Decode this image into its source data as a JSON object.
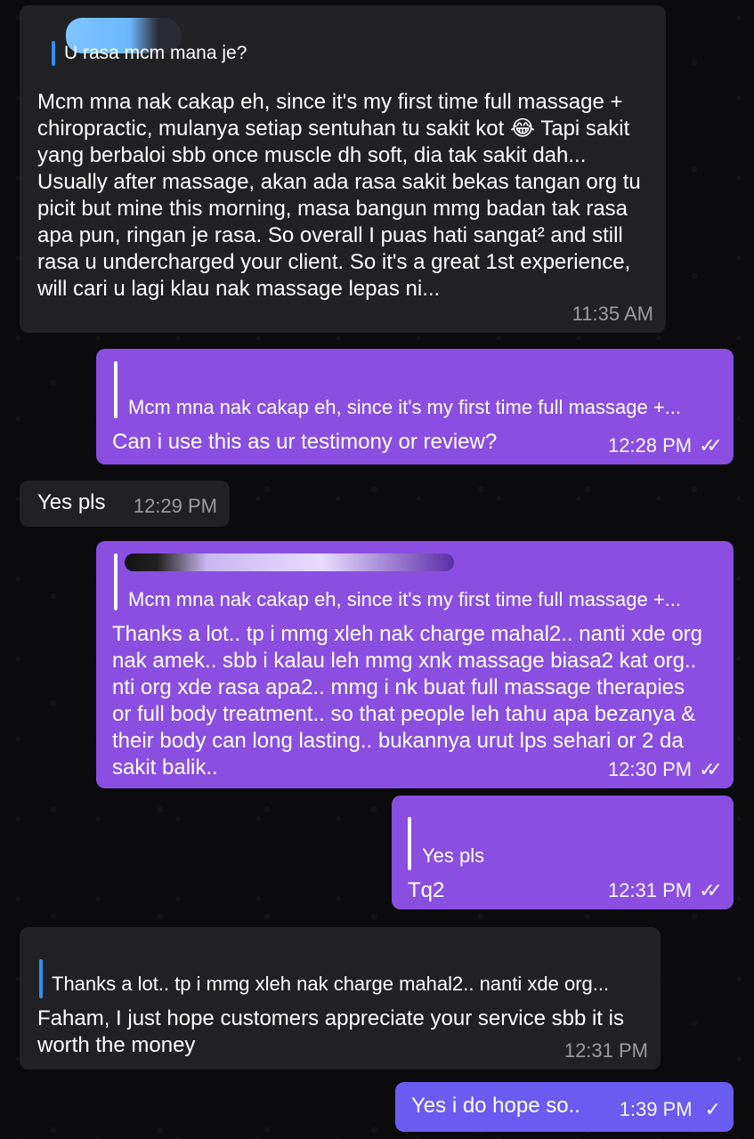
{
  "messages": [
    {
      "id": "m1",
      "direction": "incoming",
      "reply_quote": "U rasa mcm mana je?",
      "text": "Mcm mna nak cakap eh, since it's my first time full massage + chiropractic, mulanya setiap sentuhan tu sakit kot 😂 Tapi sakit yang berbaloi sbb once muscle dh soft, dia tak sakit dah... Usually after massage, akan ada rasa sakit bekas tangan org tu picit but mine this morning, masa bangun mmg badan tak rasa apa pun, ringan je rasa. So overall I puas hati sangat² and still rasa u undercharged your client. So it's a great 1st experience, will cari u lagi klau nak massage lepas ni...",
      "time": "11:35 AM"
    },
    {
      "id": "m2",
      "direction": "outgoing",
      "reply_quote": "Mcm mna nak cakap eh, since it's my first time full massage +...",
      "text": "Can i use this as ur testimony or review?",
      "time": "12:28 PM",
      "status": "read"
    },
    {
      "id": "m3",
      "direction": "incoming",
      "text": "Yes pls",
      "time": "12:29 PM"
    },
    {
      "id": "m4",
      "direction": "outgoing",
      "reply_quote": "Mcm mna nak cakap eh, since it's my first time full massage +...",
      "text": "Thanks a lot.. tp i mmg xleh nak charge mahal2.. nanti xde org nak amek.. sbb i kalau leh mmg xnk massage biasa2 kat org.. nti org xde rasa apa2.. mmg i nk buat full massage therapies or full body treatment.. so that people leh tahu apa bezanya & their body can long lasting.. bukannya urut lps sehari or 2 da sakit balik..",
      "time": "12:30 PM",
      "status": "read"
    },
    {
      "id": "m5",
      "direction": "outgoing",
      "reply_quote": "Yes pls",
      "text": "Tq2",
      "time": "12:31 PM",
      "status": "read"
    },
    {
      "id": "m6",
      "direction": "incoming",
      "reply_quote": "Thanks a lot.. tp i mmg xleh nak charge mahal2.. nanti xde org...",
      "text": "Faham, I just hope customers appreciate your service sbb it is worth the money",
      "time": "12:31 PM"
    },
    {
      "id": "m7",
      "direction": "outgoing",
      "text": "Yes i do hope so..",
      "time": "1:39 PM",
      "status": "sent"
    }
  ],
  "colors": {
    "background": "#0b0b0d",
    "incoming_bubble": "#212124",
    "outgoing_bubble": "#8a4fe0",
    "outgoing_bubble_last": "#6a5cf0",
    "reply_bar_incoming": "#2f8ff0"
  },
  "icons": {
    "read_status": "double-check-icon",
    "sent_status": "single-check-icon"
  }
}
